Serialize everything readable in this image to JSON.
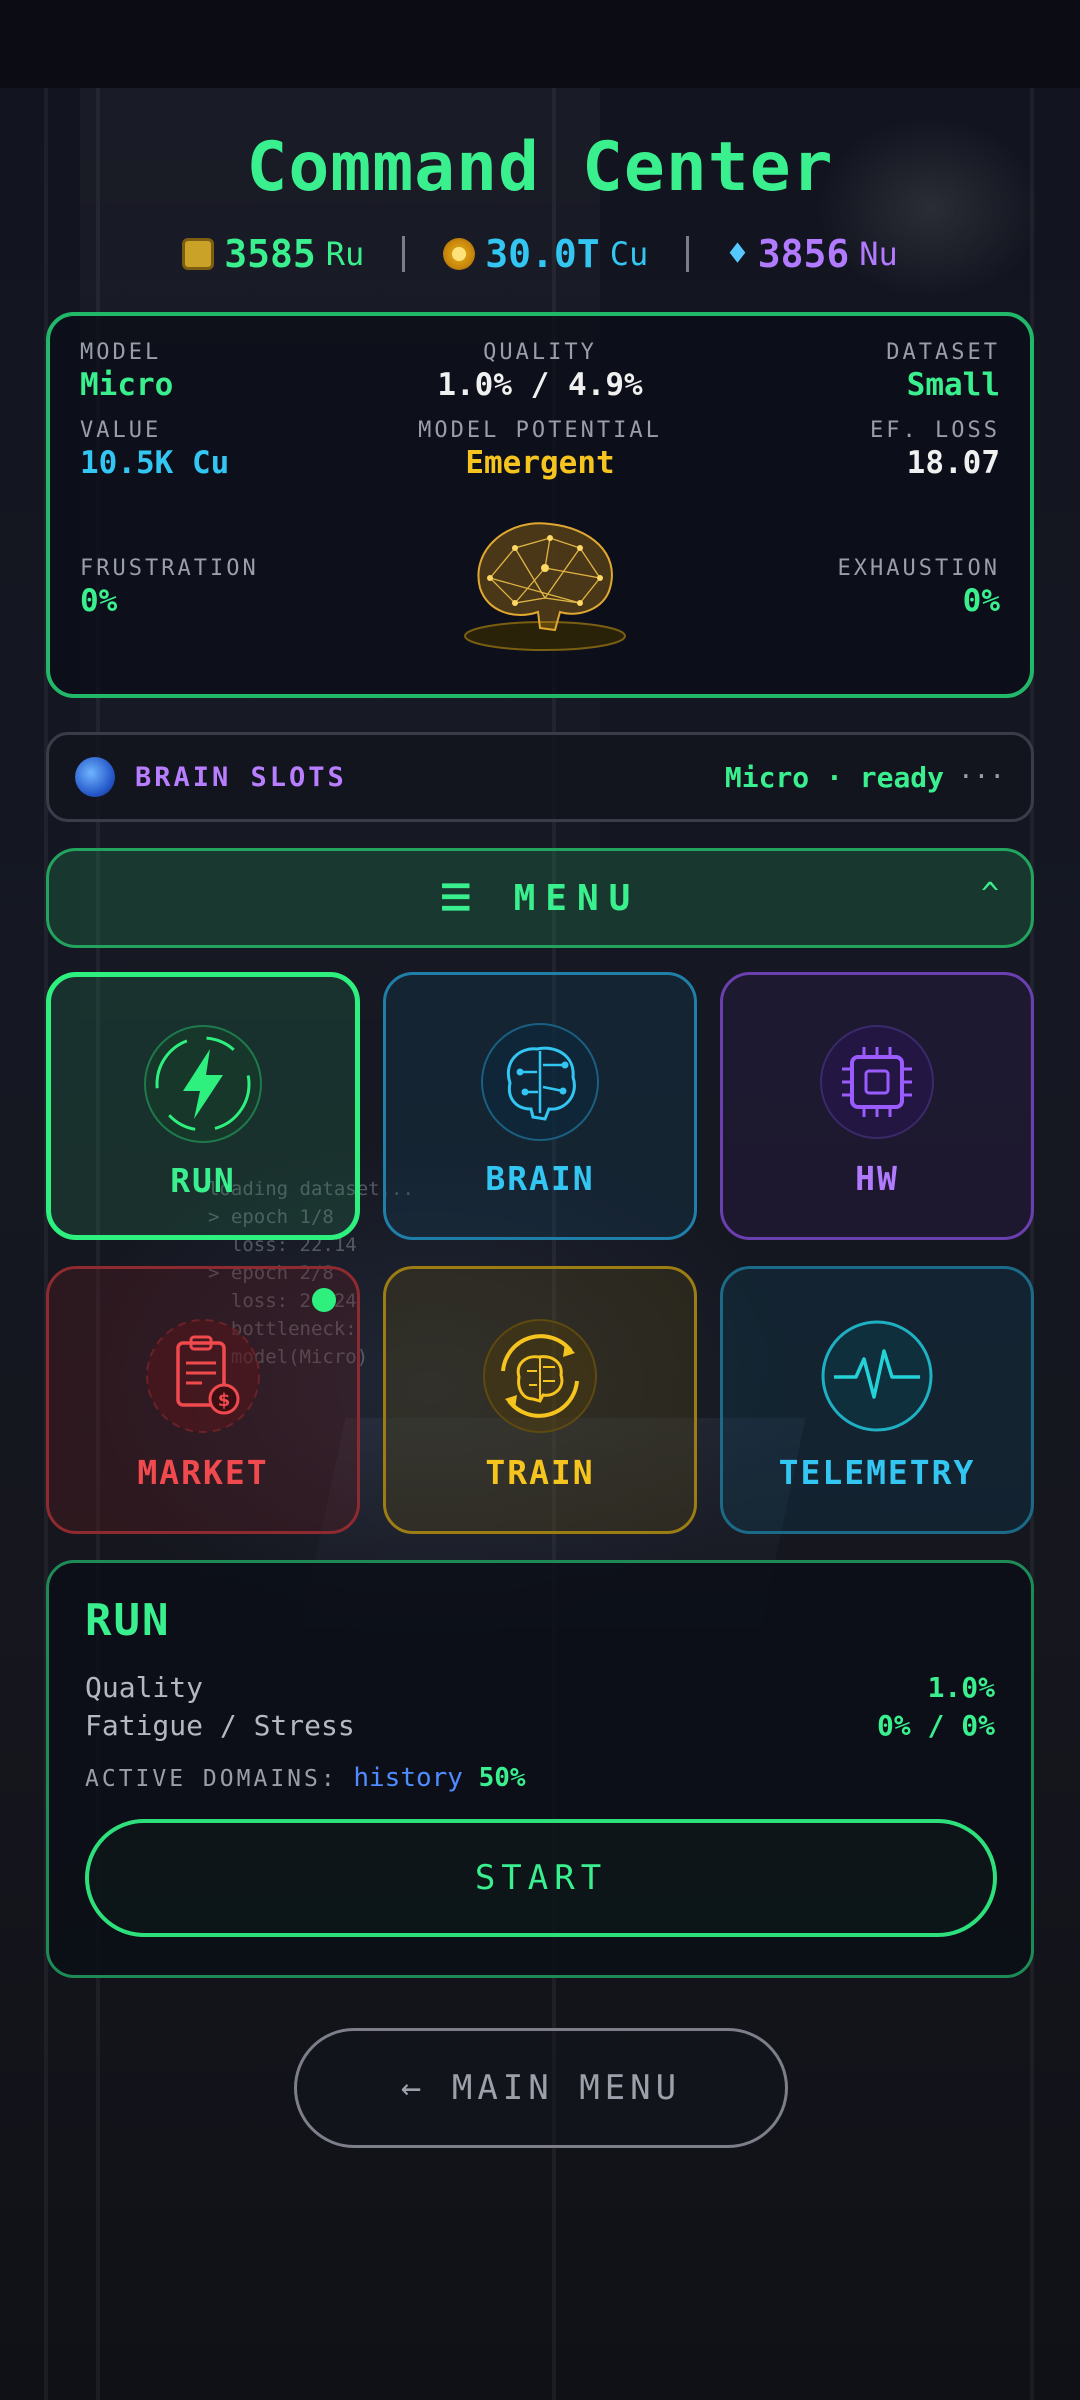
{
  "header": {
    "title": "Command Center",
    "currencies": [
      {
        "value": "3585",
        "unit": "Ru",
        "icon": "chip-coin-icon",
        "color": "#3af08e"
      },
      {
        "value": "30.0T",
        "unit": "Cu",
        "icon": "gold-coin-icon",
        "color": "#33c6f2"
      },
      {
        "value": "3856",
        "unit": "Nu",
        "icon": "diamond-icon",
        "color": "#b27aff"
      }
    ]
  },
  "stats": {
    "model": {
      "label": "MODEL",
      "value": "Micro"
    },
    "quality": {
      "label": "QUALITY",
      "value": "1.0% / 4.9%"
    },
    "dataset": {
      "label": "DATASET",
      "value": "Small"
    },
    "value": {
      "label": "VALUE",
      "value": "10.5K Cu"
    },
    "potential": {
      "label": "MODEL POTENTIAL",
      "value": "Emergent"
    },
    "ef_loss": {
      "label": "EF. LOSS",
      "value": "18.07"
    },
    "frustration": {
      "label": "FRUSTRATION",
      "value": "0%"
    },
    "exhaustion": {
      "label": "EXHAUSTION",
      "value": "0%"
    }
  },
  "brain_slots": {
    "label": "BRAIN SLOTS",
    "status": "Micro · ready",
    "more": "···"
  },
  "menu": {
    "label": "☰ MENU",
    "caret": "^"
  },
  "tiles": [
    {
      "label": "RUN",
      "icon": "lightning-icon",
      "color": "#3af08e"
    },
    {
      "label": "BRAIN",
      "icon": "brain-circuit-icon",
      "color": "#33c6f2"
    },
    {
      "label": "HW",
      "icon": "cpu-chip-icon",
      "color": "#b27aff"
    },
    {
      "label": "MARKET",
      "icon": "clipboard-dollar-icon",
      "color": "#f04a4f"
    },
    {
      "label": "TRAIN",
      "icon": "brain-cycle-icon",
      "color": "#f6c41f"
    },
    {
      "label": "TELEMETRY",
      "icon": "heartbeat-icon",
      "color": "#33c6f2"
    }
  ],
  "background_text": "loading dataset...\n> epoch 1/8\n  loss: 22.14\n> epoch 2/8\n  loss: 20.24\n  bottleneck:\n  model(Micro)",
  "run_panel": {
    "title": "RUN",
    "rows": [
      {
        "label": "Quality",
        "value": "1.0%"
      },
      {
        "label": "Fatigue / Stress",
        "value": "0% / 0%"
      }
    ],
    "domains_label": "ACTIVE DOMAINS:",
    "domain": "history",
    "domain_pct": "50%",
    "start_label": "START"
  },
  "main_menu_label": "← MAIN MENU"
}
